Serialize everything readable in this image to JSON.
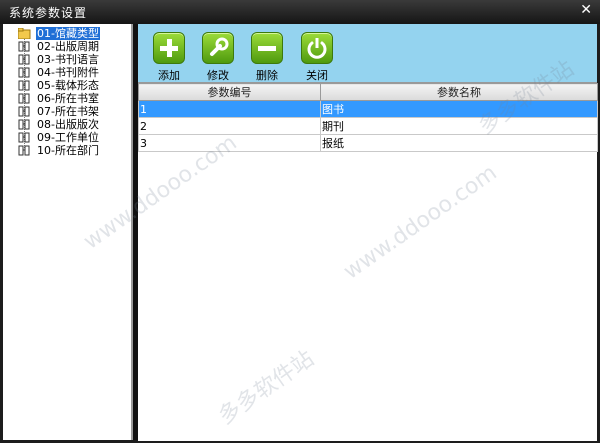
{
  "window": {
    "title": "系统参数设置"
  },
  "tree": {
    "items": [
      {
        "label": "01-馆藏类型",
        "selected": true
      },
      {
        "label": "02-出版周期"
      },
      {
        "label": "03-书刊语言"
      },
      {
        "label": "04-书刊附件"
      },
      {
        "label": "05-载体形态"
      },
      {
        "label": "06-所在书室"
      },
      {
        "label": "07-所在书架"
      },
      {
        "label": "08-出版版次"
      },
      {
        "label": "09-工作单位"
      },
      {
        "label": "10-所在部门"
      }
    ]
  },
  "toolbar": {
    "add": "添加",
    "edit": "修改",
    "delete": "删除",
    "close": "关闭"
  },
  "table": {
    "headers": [
      "参数编号",
      "参数名称"
    ],
    "rows": [
      {
        "id": "1",
        "name": "图书",
        "selected": true
      },
      {
        "id": "2",
        "name": "期刊"
      },
      {
        "id": "3",
        "name": "报纸"
      }
    ]
  },
  "watermark": {
    "brand": "多多软件站",
    "site": "www.ddooo.com"
  },
  "colors": {
    "toolbar_bg": "#94d3ef",
    "selection": "#3399ff",
    "button_green": "#6cb520"
  }
}
